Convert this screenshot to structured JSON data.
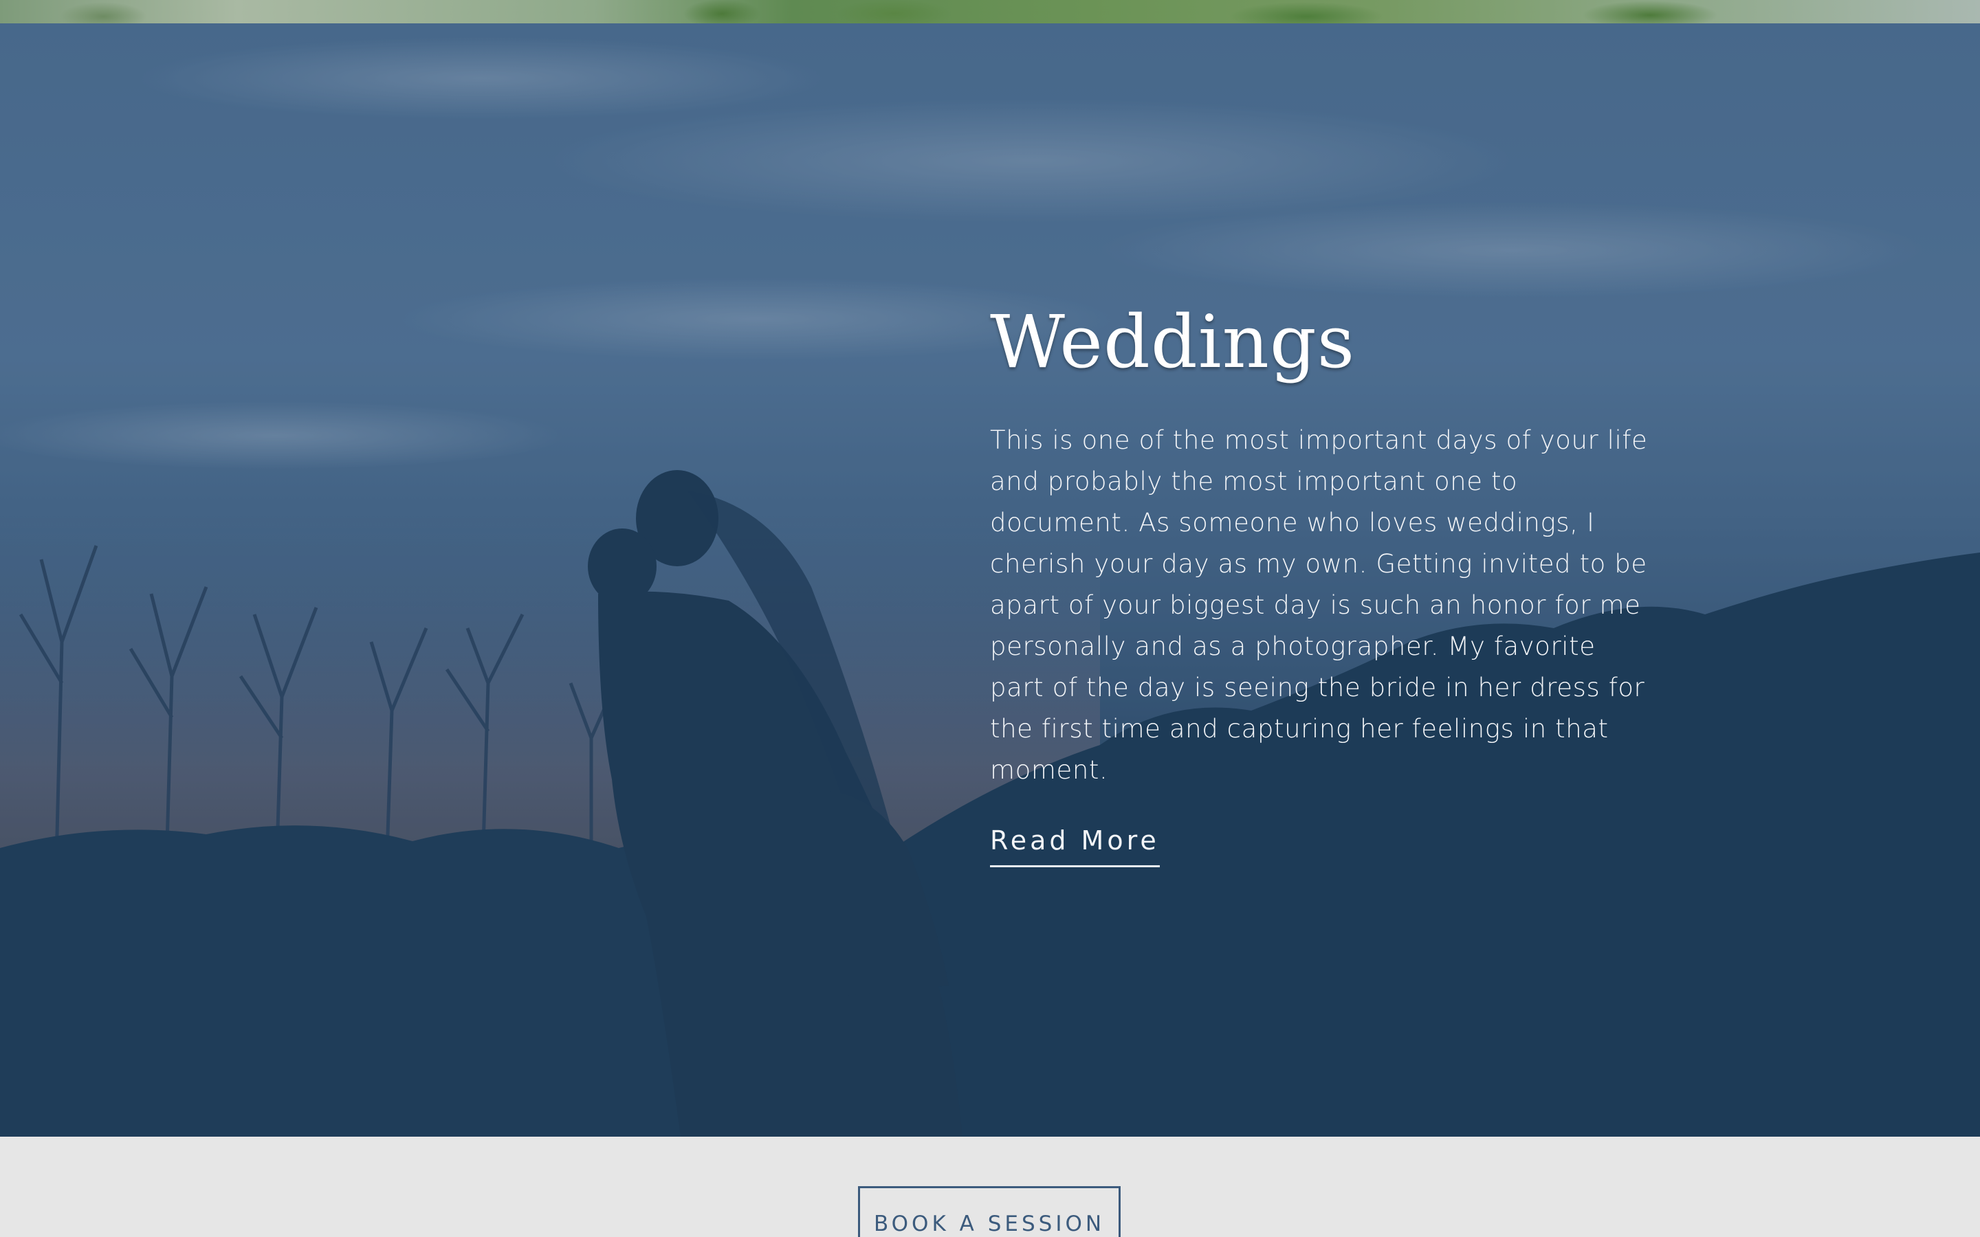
{
  "hero": {
    "title": "Weddings",
    "description": "This is one of the most important days of your life and probably the most important one to document. As someone who loves weddings, I cherish your day as my own. Getting invited to be apart of your biggest day is such an honor for me personally and as a photographer. My favorite part of the day is seeing the bride in her dress for the first time and capturing her feelings in that moment.",
    "read_more_label": "Read More"
  },
  "cta": {
    "book_label": "BOOK A SESSION"
  },
  "colors": {
    "overlay": "#1d3c58",
    "sky": "#5a7ba0",
    "button_border": "#3c5b7d",
    "band": "#e6e6e6"
  }
}
